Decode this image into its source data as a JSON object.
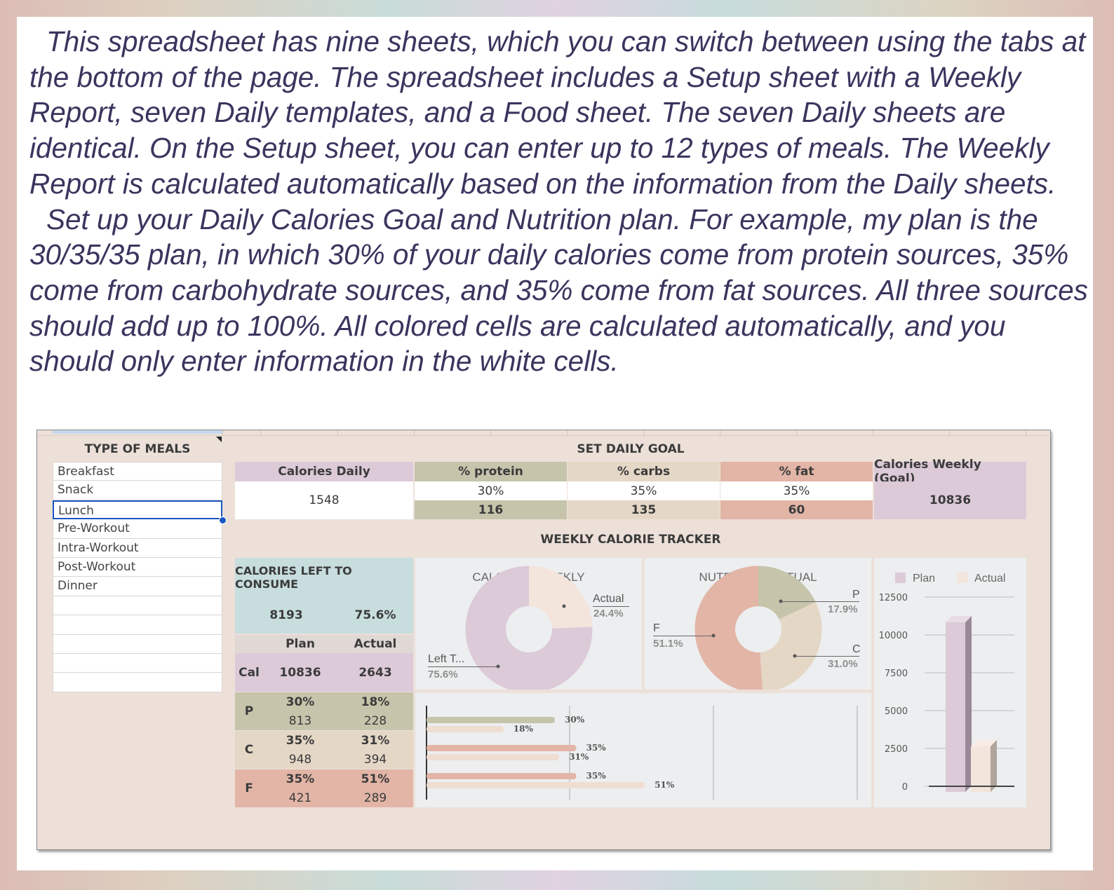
{
  "intro": {
    "paragraph1": "This spreadsheet has nine sheets, which you can switch between using the tabs at the bottom of the page. The spreadsheet includes a Setup sheet with a Weekly Report, seven Daily templates, and a Food sheet. The seven Daily sheets are identical. On the Setup sheet, you can enter up to 12 types of meals. The Weekly Report is calculated automatically based on the information from the Daily sheets.",
    "paragraph2": "Set up your Daily Calories Goal and Nutrition plan. For example, my plan is the 30/35/35 plan, in which 30% of your daily calories come from protein sources, 35% come from carbohydrate sources, and 35% come from fat sources. All three sources should add up to 100%. All colored cells are calculated automatically, and you should only enter information in the white cells."
  },
  "meals": {
    "header": "TYPE OF MEALS",
    "items": [
      "Breakfast",
      "Snack",
      "Lunch",
      "Pre-Workout",
      "Intra-Workout",
      "Post-Workout",
      "Dinner",
      "",
      "",
      "",
      "",
      ""
    ]
  },
  "goal": {
    "header": "SET DAILY GOAL",
    "calories_daily_label": "Calories Daily",
    "calories_daily_value": "1548",
    "protein_label": "% protein",
    "protein_pct": "30%",
    "protein_grams": "116",
    "carbs_label": "% carbs",
    "carbs_pct": "35%",
    "carbs_grams": "135",
    "fat_label": "% fat",
    "fat_pct": "35%",
    "fat_grams": "60",
    "weekly_label": "Calories Weekly (Goal)",
    "weekly_value": "10836"
  },
  "tracker": {
    "header": "WEEKLY CALORIE TRACKER",
    "left_title": "CALORIES LEFT TO CONSUME",
    "left_value": "8193",
    "left_pct": "75.6%",
    "plan_label": "Plan",
    "actual_label": "Actual",
    "rows": [
      {
        "key": "Cal",
        "plan": "10836",
        "actual": "2643"
      },
      {
        "key": "P",
        "plan_pct": "30%",
        "plan": "813",
        "actual_pct": "18%",
        "actual": "228"
      },
      {
        "key": "C",
        "plan_pct": "35%",
        "plan": "948",
        "actual_pct": "31%",
        "actual": "394"
      },
      {
        "key": "F",
        "plan_pct": "35%",
        "plan": "421",
        "actual_pct": "51%",
        "actual": "289"
      }
    ]
  },
  "colors": {
    "sheet_bg": "#ece0d9",
    "protein": "#c6c4ab",
    "carbs": "#e5d7c6",
    "fat": "#e2b5a6",
    "calories": "#dccad8",
    "left": "#c8dddd",
    "plan_bar": "#c8c6b0",
    "actual_bar": "#f0ddd2"
  },
  "chart_data": [
    {
      "type": "pie",
      "title": "CALORIES WEEKLY",
      "labels": [
        "Actual",
        "Left T..."
      ],
      "values": [
        24.4,
        75.6
      ],
      "value_labels": [
        "24.4%",
        "75.6%"
      ]
    },
    {
      "type": "pie",
      "title": "NUTRIENTS ACTUAL",
      "labels": [
        "P",
        "C",
        "F"
      ],
      "values": [
        17.9,
        31.0,
        51.1
      ],
      "value_labels": [
        "17.9%",
        "31.0%",
        "51.1%"
      ]
    },
    {
      "type": "bar",
      "orientation": "horizontal",
      "categories": [
        "P",
        "C",
        "F"
      ],
      "series": [
        {
          "values": [
            30,
            35,
            35
          ],
          "labels": [
            "30%",
            "35%",
            "35%"
          ]
        },
        {
          "values": [
            18,
            31,
            51
          ],
          "labels": [
            "18%",
            "31%",
            "51%"
          ]
        }
      ]
    },
    {
      "type": "bar",
      "categories": [
        ""
      ],
      "series": [
        {
          "name": "Plan",
          "values": [
            10836
          ]
        },
        {
          "name": "Actual",
          "values": [
            2643
          ]
        }
      ],
      "ylim": [
        0,
        12500
      ],
      "yticks": [
        "12500",
        "10000",
        "7500",
        "5000",
        "2500",
        "0"
      ],
      "legend": "top"
    }
  ]
}
